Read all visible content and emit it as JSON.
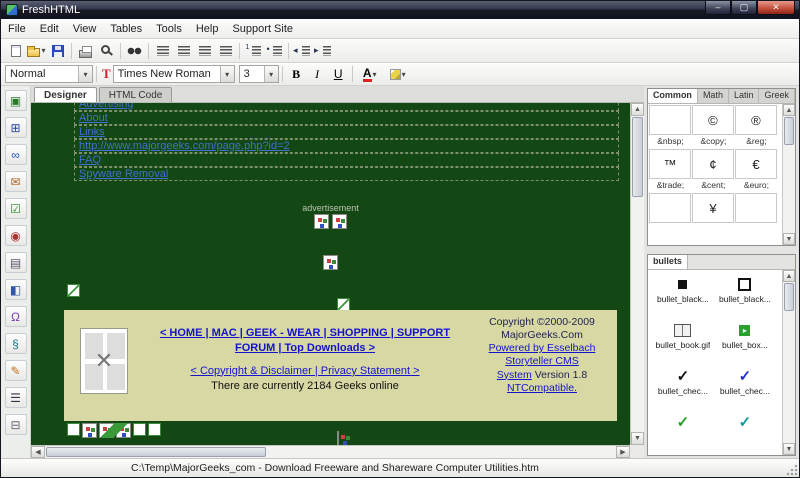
{
  "window": {
    "title": "FreshHTML",
    "minimize_glyph": "–",
    "maximize_glyph": "▢",
    "close_glyph": "✕"
  },
  "menu": {
    "items": [
      "File",
      "Edit",
      "View",
      "Tables",
      "Tools",
      "Help",
      "Support Site"
    ]
  },
  "toolbar": {
    "icons": [
      "new-document",
      "open-folder",
      "save",
      "print",
      "print-preview",
      "find",
      "align-left",
      "align-center",
      "align-right",
      "justify",
      "numbered-list",
      "bullet-list",
      "outdent",
      "indent"
    ]
  },
  "format_bar": {
    "style_value": "Normal",
    "font_icon": "T",
    "font_value": "Times New Roman",
    "size_value": "3",
    "bold": "B",
    "italic": "I",
    "underline": "U",
    "font_color": "A"
  },
  "sidebar": {
    "items": [
      {
        "name": "insert-image",
        "glyph": "▣",
        "color": "#2a7a2a"
      },
      {
        "name": "insert-table",
        "glyph": "⊞",
        "color": "#2244aa"
      },
      {
        "name": "insert-hyperlink",
        "glyph": "∞",
        "color": "#2255cc"
      },
      {
        "name": "insert-email-link",
        "glyph": "✉",
        "color": "#b06020"
      },
      {
        "name": "insert-checkbox",
        "glyph": "☑",
        "color": "#2a8a2a"
      },
      {
        "name": "insert-radio-button",
        "glyph": "◉",
        "color": "#aa3333"
      },
      {
        "name": "insert-textarea",
        "glyph": "▤",
        "color": "#556"
      },
      {
        "name": "insert-dropdown",
        "glyph": "◧",
        "color": "#3355aa"
      },
      {
        "name": "insert-special-character",
        "glyph": "Ω",
        "color": "#7a3faa"
      },
      {
        "name": "insert-script",
        "glyph": "§",
        "color": "#117788"
      },
      {
        "name": "edit-tag",
        "glyph": "✎",
        "color": "#c07020"
      },
      {
        "name": "insert-list",
        "glyph": "☰",
        "color": "#334"
      },
      {
        "name": "insert-horizontal-rule",
        "glyph": "⊟",
        "color": "#667"
      }
    ]
  },
  "tabs": {
    "items": [
      "Designer",
      "HTML Code"
    ],
    "active": "Designer"
  },
  "designer": {
    "menu_links": [
      "Advertising",
      "About",
      "Links",
      "http://www.majorgeeks.com/page.php?id=2",
      "FAQ",
      "Spyware Removal"
    ],
    "ad_label": "advertisement",
    "footer_box": {
      "nav_links": "< HOME | MAC | GEEK - WEAR | SHOPPING | SUPPORT FORUM | Top Downloads >",
      "legal_links": "< Copyright & Disclaimer | Privacy Statement >",
      "online_count": "There are currently 2184 Geeks online",
      "copyright": {
        "line1": "Copyright ©2000-2009",
        "line2": "MajorGeeks.Com",
        "line3": "Powered by Esselbach",
        "line4": "Storyteller CMS",
        "line5_link": "System",
        "line5_text": "Version 1.8",
        "line6": "NTCompatible."
      }
    }
  },
  "char_map": {
    "tabs": [
      "Common",
      "Math",
      "Latin",
      "Greek"
    ],
    "cells": [
      {
        "symbol": " ",
        "entity": "&nbsp;"
      },
      {
        "symbol": "©",
        "entity": "&copy;"
      },
      {
        "symbol": "®",
        "entity": "&reg;"
      },
      {
        "symbol": "™",
        "entity": "&trade;"
      },
      {
        "symbol": "¢",
        "entity": "&cent;"
      },
      {
        "symbol": "€",
        "entity": "&euro;"
      },
      {
        "symbol": "",
        "entity": ""
      },
      {
        "symbol": "¥",
        "entity": ""
      },
      {
        "symbol": "",
        "entity": ""
      }
    ]
  },
  "bullets": {
    "tab": "bullets",
    "items": [
      {
        "label": "bullet_black...",
        "icon": "black-square"
      },
      {
        "label": "bullet_black...",
        "icon": "outline-square"
      },
      {
        "label": "bullet_book.gif",
        "icon": "book"
      },
      {
        "label": "bullet_box...",
        "icon": "green-box"
      },
      {
        "label": "bullet_chec...",
        "icon": "black-check"
      },
      {
        "label": "bullet_chec...",
        "icon": "blue-check"
      },
      {
        "label": "",
        "icon": "green-check"
      },
      {
        "label": "",
        "icon": "teal-check"
      }
    ]
  },
  "status_bar": {
    "text": "C:\\Temp\\MajorGeeks_com - Download Freeware and Shareware Computer Utilities.htm"
  }
}
